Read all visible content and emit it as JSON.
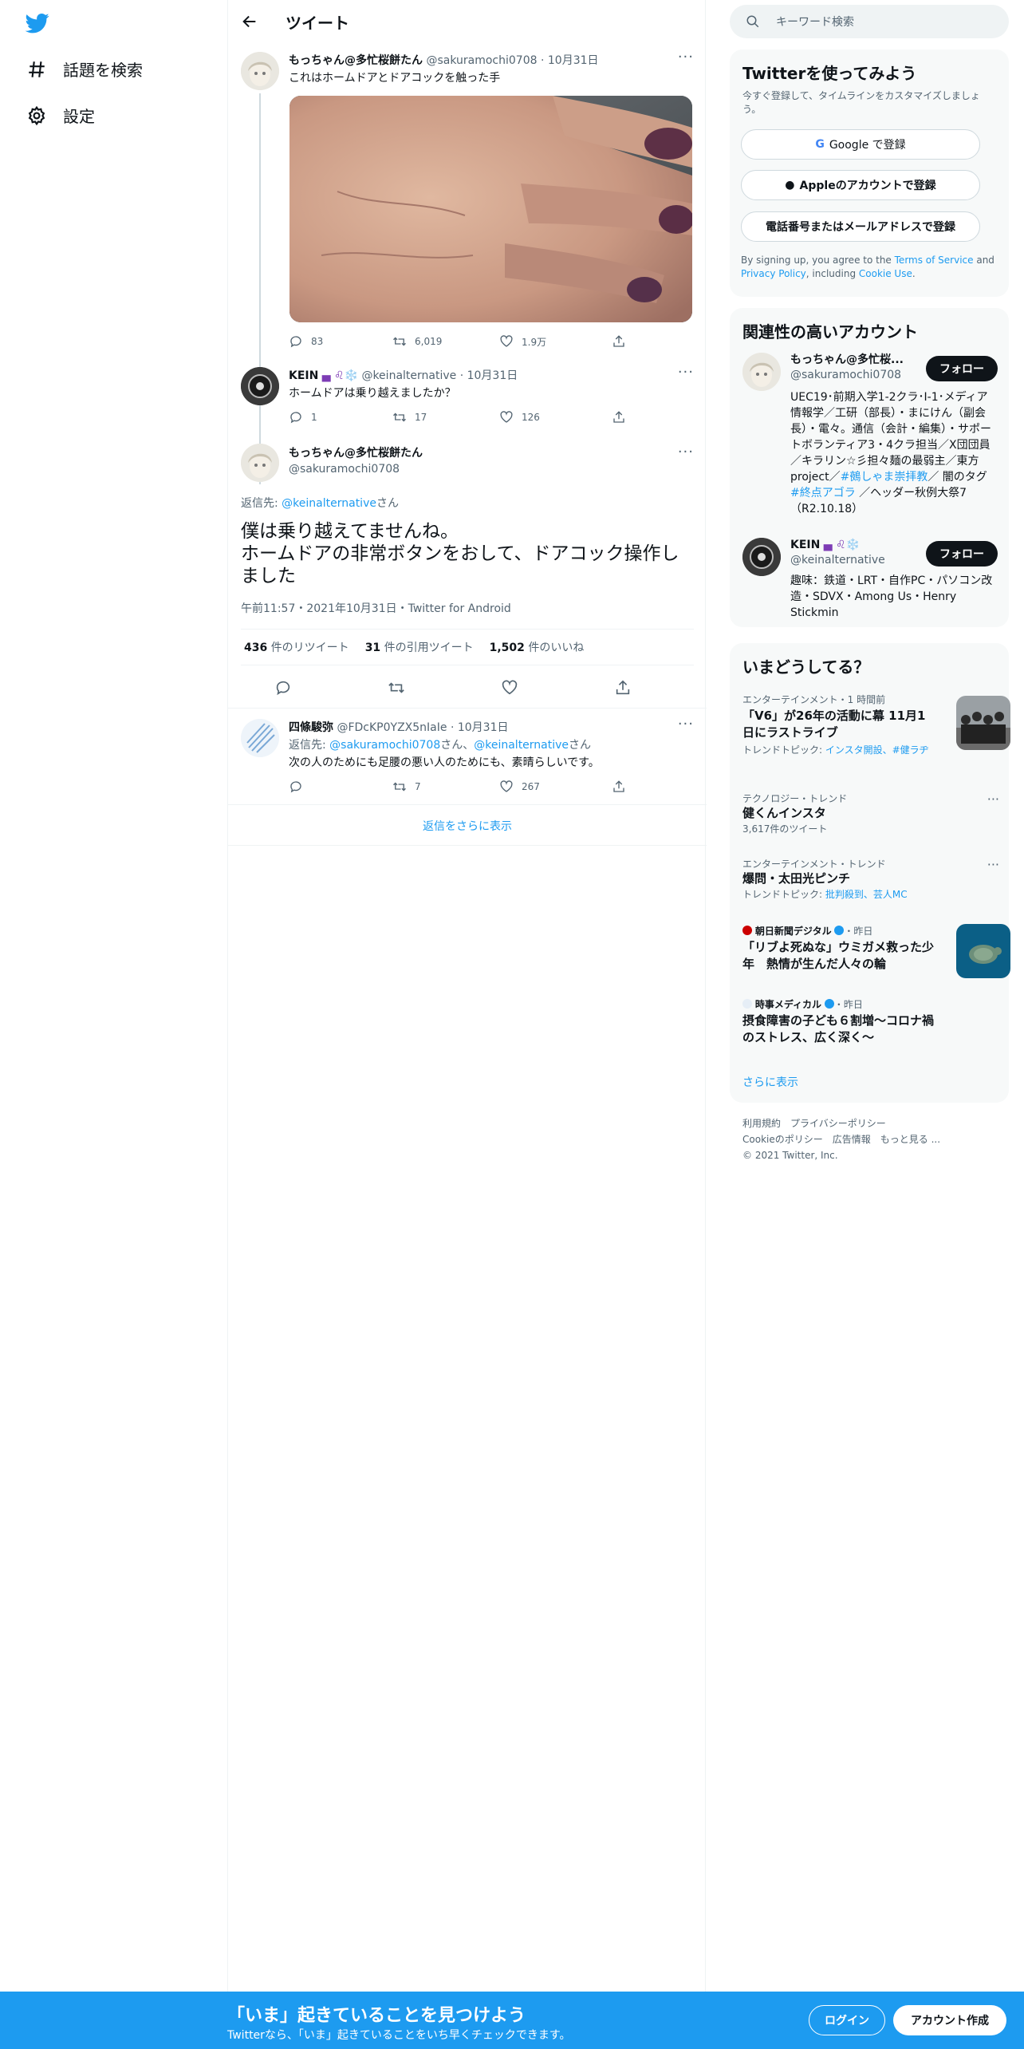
{
  "nav": {
    "explore": "話題を検索",
    "settings": "設定"
  },
  "header": {
    "title": "ツイート"
  },
  "thread": {
    "first": {
      "name": "もっちゃん@多忙桜餅たん",
      "handle": "@sakuramochi0708",
      "date": "10月31日",
      "text": "これはホームドアとドアコックを触った手",
      "replies": "83",
      "retweets": "6,019",
      "likes": "1.9万"
    },
    "second": {
      "name": "KEIN",
      "name_emoji": "▄ ♌❄️",
      "handle": "@keinalternative",
      "date": "10月31日",
      "text": "ホームドアは乗り越えましたか？",
      "replies": "1",
      "retweets": "17",
      "likes": "126"
    },
    "main": {
      "name": "もっちゃん@多忙桜餅たん",
      "handle": "@sakuramochi0708",
      "reply_prefix": "返信先: ",
      "reply_to": "@keinalternative",
      "reply_suffix": "さん",
      "text_line1": "僕は乗り越えてませんね。",
      "text_line2": "ホームドアの非常ボタンをおして、ドアコック操作しました",
      "meta": "午前11:57・2021年10月31日・Twitter for Android",
      "retweet_count": "436",
      "retweet_label": "件のリツイート",
      "quote_count": "31",
      "quote_label": "件の引用ツイート",
      "like_count": "1,502",
      "like_label": "件のいいね"
    },
    "reply": {
      "name": "四條駿弥",
      "handle": "@FDcKP0YZX5nIaIe",
      "date": "10月31日",
      "reply_prefix": "返信先: ",
      "reply_to1": "@sakuramochi0708",
      "reply_mid": "さん、",
      "reply_to2": "@keinalternative",
      "reply_suffix": "さん",
      "text": "次の人のためにも足腰の悪い人のためにも、素晴らしいです。",
      "retweets": "7",
      "likes": "267"
    },
    "show_more": "返信をさらに表示"
  },
  "search": {
    "placeholder": "キーワード検索"
  },
  "signup": {
    "title": "Twitterを使ってみよう",
    "subtitle": "今すぐ登録して、タイムラインをカスタマイズしましょう。",
    "google": "Google で登録",
    "apple": "Appleのアカウントで登録",
    "phone": "電話番号またはメールアドレスで登録",
    "legal_1": "By signing up, you agree to the ",
    "terms": "Terms of Service",
    "legal_and": " and ",
    "privacy": "Privacy Policy",
    "legal_inc": ", including ",
    "cookie": "Cookie Use",
    "legal_end": "."
  },
  "related": {
    "title": "関連性の高いアカウント",
    "follow": "フォロー",
    "acc1": {
      "name": "もっちゃん@多忙桜...",
      "handle": "@sakuramochi0708",
      "bio_1": "UEC19･前期入学1-2クラ･Ⅰ-1･メディア情報学／工研（部長）・まにけん（副会長）・電々。通信（会計・編集）・サポートボランティア3・4クラ担当／X団団員／キラリン☆彡担々麺の最弱主／東方project／",
      "bio_tag1": "#鵺しゃま崇拝教",
      "bio_2": "／ 闇のタグ ",
      "bio_tag2": "#終点アゴラ",
      "bio_3": " ／ヘッダー秋例大祭7（R2.10.18）"
    },
    "acc2": {
      "name": "KEIN",
      "name_emoji": "▄ ♌❄️",
      "handle": "@keinalternative",
      "bio": "趣味：鉄道・LRT・自作PC・パソコン改造・SDVX・Among Us・Henry Stickmin"
    }
  },
  "trends": {
    "title": "いまどうしてる？",
    "items": [
      {
        "meta": "エンターテインメント・1 時間前",
        "title": "「V6」が26年の活動に幕 11月1日にラストライブ",
        "sub_prefix": "トレンドトピック: ",
        "sub": "インスタ開設、#健ラヂ"
      },
      {
        "meta": "テクノロジー・トレンド",
        "title": "健くんインスタ",
        "sub": "3,617件のツイート"
      },
      {
        "meta": "エンターテインメント・トレンド",
        "title": "爆問・太田光ピンチ",
        "sub_prefix": "トレンドトピック: ",
        "sub": "批判殺到、芸人MC"
      },
      {
        "source": "朝日新聞デジタル",
        "when": "・昨日",
        "title": "「リブよ死ぬな」ウミガメ救った少年　熱情が生んだ人々の輪"
      },
      {
        "source": "時事メディカル",
        "when": "・昨日",
        "title": "摂食障害の子ども６割増～コロナ禍のストレス、広く深く～"
      }
    ],
    "more": "さらに表示"
  },
  "footer": {
    "l1": "利用規約",
    "l2": "プライバシーポリシー",
    "l3": "Cookieのポリシー",
    "l4": "広告情報",
    "l5": "もっと見る ...",
    "copy": "© 2021 Twitter, Inc."
  },
  "bottom": {
    "title": "「いま」起きていることを見つけよう",
    "subtitle": "Twitterなら、「いま」起きていることをいち早くチェックできます。",
    "login": "ログイン",
    "signup": "アカウント作成"
  },
  "colors": {
    "accent": "#1d9bf0",
    "text": "#0f1419",
    "muted": "#536471",
    "card": "#f7f9f9"
  }
}
